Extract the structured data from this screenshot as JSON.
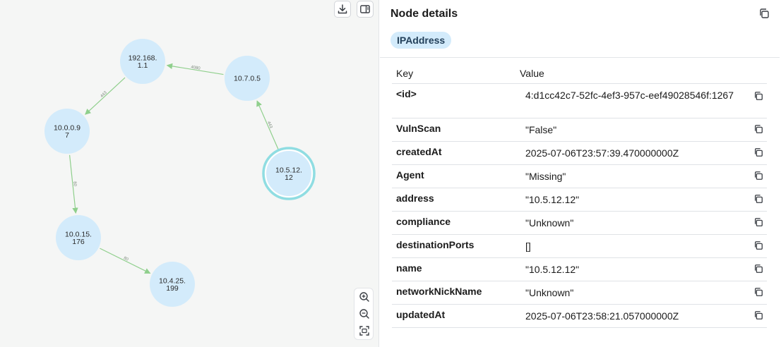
{
  "graph": {
    "nodes": [
      {
        "id": "n1",
        "lines": [
          "192.168.",
          "1.1"
        ],
        "selected": false
      },
      {
        "id": "n2",
        "lines": [
          "10.7.0.5"
        ],
        "selected": false
      },
      {
        "id": "n3",
        "lines": [
          "10.0.0.9",
          "7"
        ],
        "selected": false
      },
      {
        "id": "n4",
        "lines": [
          "10.5.12.",
          "12"
        ],
        "selected": true
      },
      {
        "id": "n5",
        "lines": [
          "10.0.15.",
          "176"
        ],
        "selected": false
      },
      {
        "id": "n6",
        "lines": [
          "10.4.25.",
          "199"
        ],
        "selected": false
      }
    ],
    "edges": [
      {
        "from": "n2",
        "to": "n1",
        "label": "4080"
      },
      {
        "from": "n1",
        "to": "n3",
        "label": "443"
      },
      {
        "from": "n4",
        "to": "n2",
        "label": "443"
      },
      {
        "from": "n3",
        "to": "n5",
        "label": "80"
      },
      {
        "from": "n5",
        "to": "n6",
        "label": "80"
      }
    ],
    "colors": {
      "node_fill": "#d3ebfb",
      "selected_ring": "#8fdde2",
      "edge": "#8fcf8c"
    }
  },
  "toolbar": {
    "download_icon": "download-icon",
    "panel_toggle_icon": "panel-toggle-icon",
    "zoom_in_icon": "zoom-in-icon",
    "zoom_out_icon": "zoom-out-icon",
    "fit_icon": "fit-view-icon"
  },
  "details": {
    "title": "Node details",
    "label": "IPAddress",
    "columns": {
      "key": "Key",
      "value": "Value"
    },
    "properties": [
      {
        "key": "<id>",
        "value": "4:d1cc42c7-52fc-4ef3-957c-eef49028546f:1267"
      },
      {
        "key": "VulnScan",
        "value": "\"False\""
      },
      {
        "key": "createdAt",
        "value": "2025-07-06T23:57:39.470000000Z"
      },
      {
        "key": "Agent",
        "value": "\"Missing\""
      },
      {
        "key": "address",
        "value": "\"10.5.12.12\""
      },
      {
        "key": "compliance",
        "value": "\"Unknown\""
      },
      {
        "key": "destinationPorts",
        "value": "[]"
      },
      {
        "key": "name",
        "value": "\"10.5.12.12\""
      },
      {
        "key": "networkNickName",
        "value": "\"Unknown\""
      },
      {
        "key": "updatedAt",
        "value": "2025-07-06T23:58:21.057000000Z"
      }
    ]
  }
}
